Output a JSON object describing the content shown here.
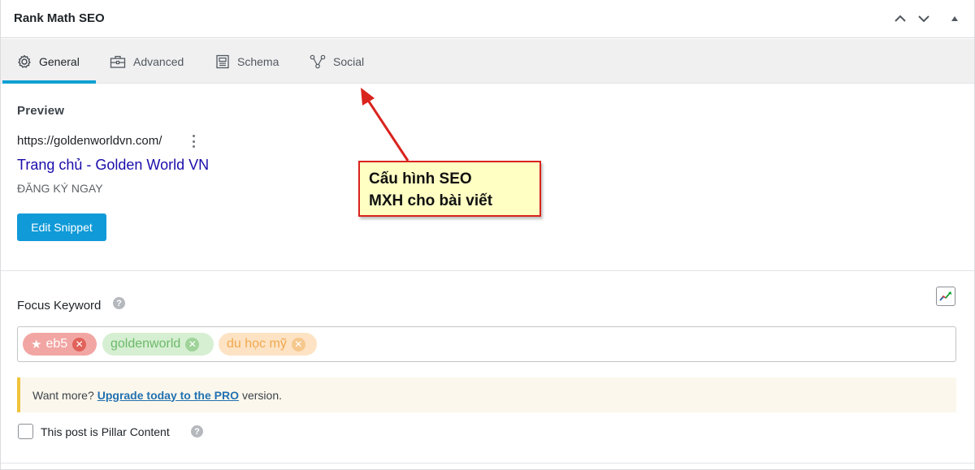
{
  "metabox": {
    "title": "Rank Math SEO"
  },
  "tabs": [
    {
      "label": "General",
      "icon": "gear-icon",
      "active": true
    },
    {
      "label": "Advanced",
      "icon": "toolbox-icon",
      "active": false
    },
    {
      "label": "Schema",
      "icon": "schema-icon",
      "active": false
    },
    {
      "label": "Social",
      "icon": "social-share-icon",
      "active": false
    }
  ],
  "preview": {
    "heading": "Preview",
    "url": "https://goldenworldvn.com/",
    "title": "Trang chủ - Golden World VN",
    "description": "ĐĂNG KÝ NGAY",
    "edit_button": "Edit Snippet"
  },
  "focus_keyword": {
    "label": "Focus Keyword",
    "help": "?",
    "keywords": [
      {
        "text": "eb5",
        "primary": true,
        "color": "#f2a6a3"
      },
      {
        "text": "goldenworld",
        "primary": false,
        "color": "#d6efd2"
      },
      {
        "text": "du học mỹ",
        "primary": false,
        "color": "#fde3c4"
      }
    ]
  },
  "notice": {
    "prefix": "Want more?",
    "link": "Upgrade today to the PRO",
    "suffix": "version."
  },
  "pillar": {
    "label": "This post is Pillar Content",
    "checked": false
  },
  "annotation": {
    "line1": "Cấu hình SEO",
    "line2": "MXH cho bài viết"
  },
  "colors": {
    "accent": "#10a0d3",
    "serp_link": "#1a0dab",
    "annotation_border": "#d9231d"
  }
}
